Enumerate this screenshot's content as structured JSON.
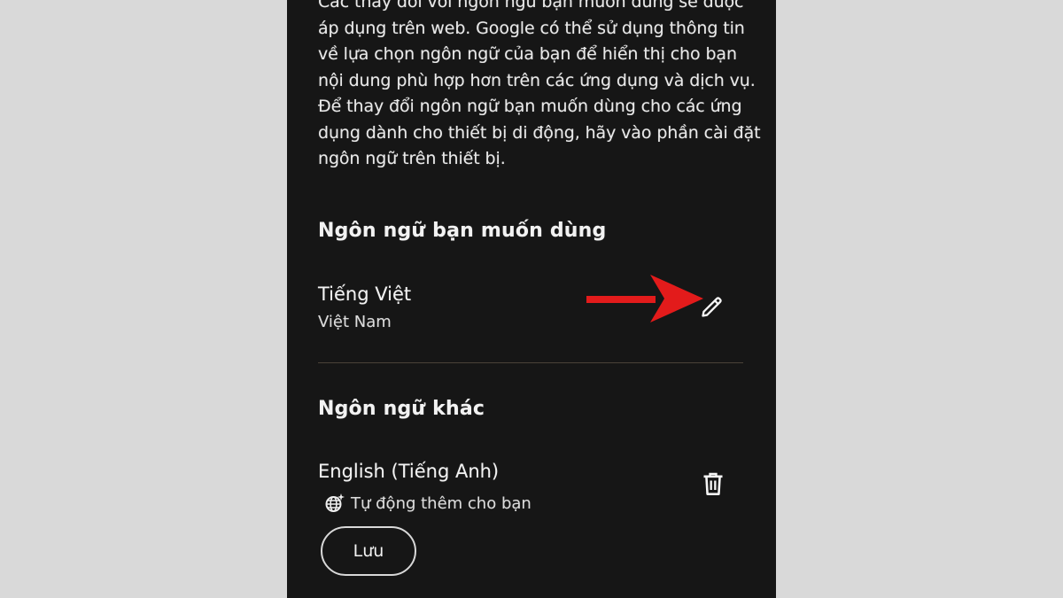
{
  "intro_text": "Các thay đổi với ngôn ngữ bạn muốn dùng sẽ được áp dụng trên web. Google có thể sử dụng thông tin về lựa chọn ngôn ngữ của bạn để hiển thị cho bạn nội dung phù hợp hơn trên các ứng dụng và dịch vụ. Để thay đổi ngôn ngữ bạn muốn dùng cho các ứng dụng dành cho thiết bị di động, hãy vào phần cài đặt ngôn ngữ trên thiết bị.",
  "preferred": {
    "title": "Ngôn ngữ bạn muốn dùng",
    "language": "Tiếng Việt",
    "region": "Việt Nam",
    "edit_icon": "pencil-icon"
  },
  "other": {
    "title": "Ngôn ngữ khác",
    "language": "English (Tiếng Anh)",
    "auto_added": "Tự động thêm cho bạn",
    "auto_icon": "globe-sparkle-icon",
    "delete_icon": "trash-icon"
  },
  "save_label": "Lưu",
  "colors": {
    "page_background": "#d9d9d9",
    "screen_background": "#161616",
    "text": "#f2f2f2",
    "annotation_arrow": "#e31b1b"
  }
}
